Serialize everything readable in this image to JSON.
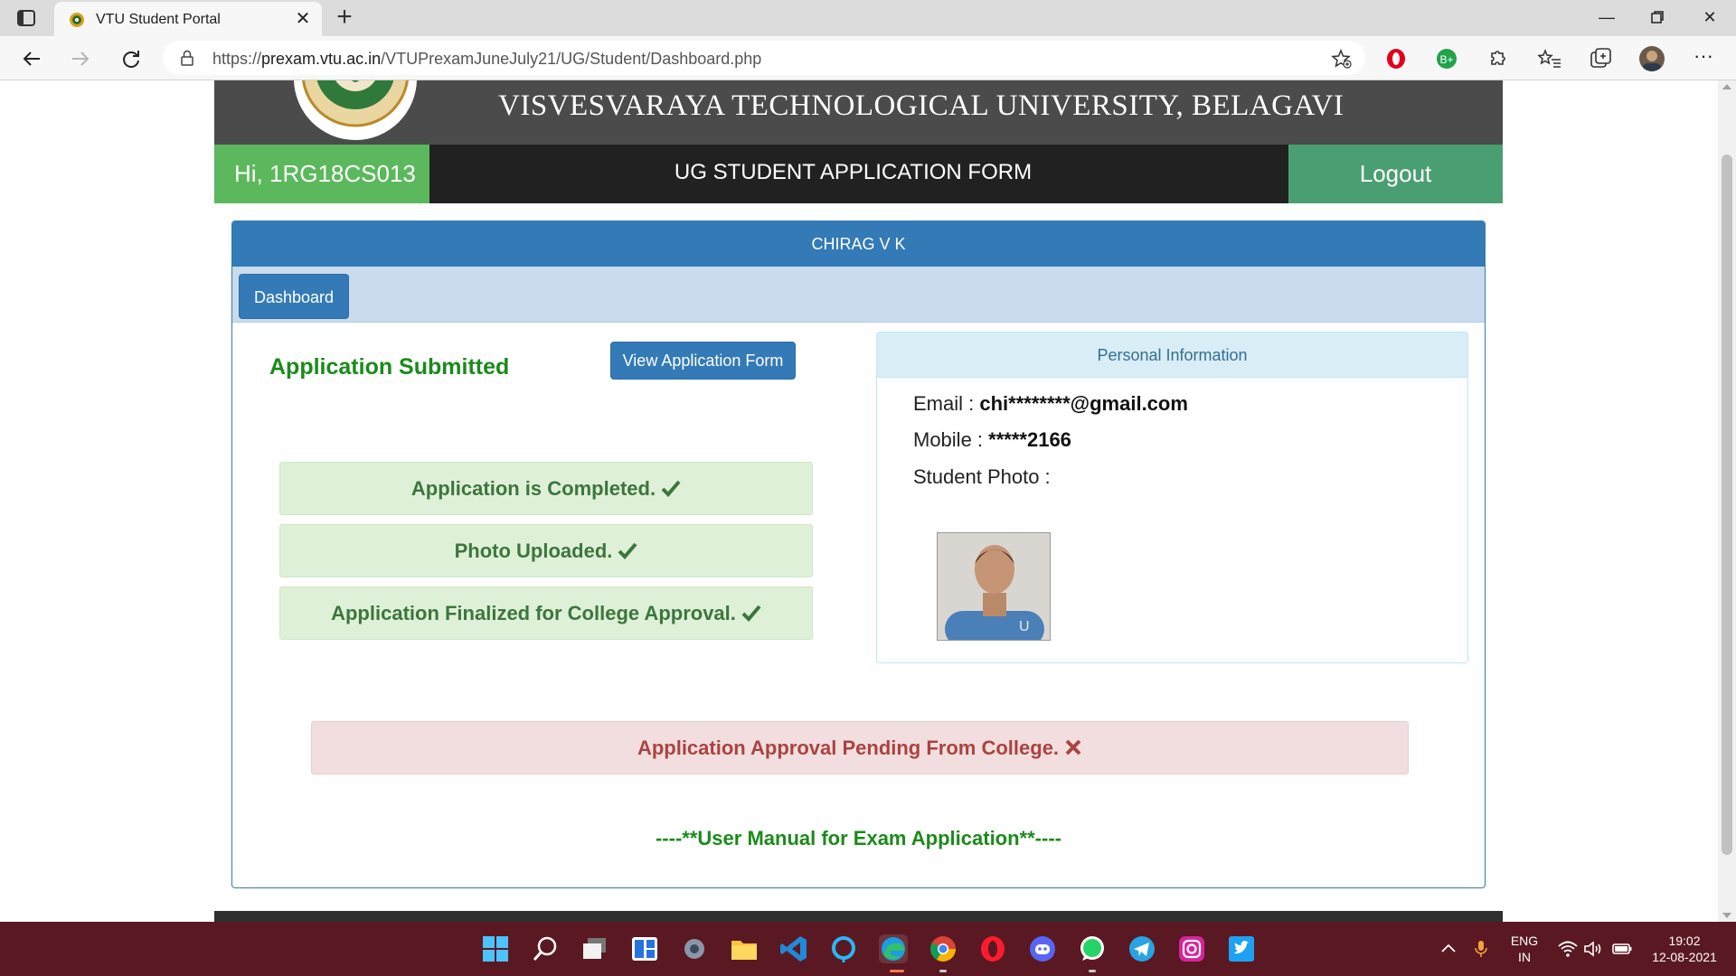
{
  "browser": {
    "tab_title": "VTU Student Portal",
    "url_prefix": "https://",
    "url_host": "prexam.vtu.ac.in",
    "url_path": "/VTUPrexamJuneJuly21/UG/Student/Dashboard.php"
  },
  "header": {
    "university_name": "VISVESVARAYA TECHNOLOGICAL UNIVERSITY, BELAGAVI",
    "greeting": "Hi, 1RG18CS013",
    "form_title": "UG STUDENT APPLICATION FORM",
    "logout_label": "Logout"
  },
  "panel": {
    "student_name": "CHIRAG V K",
    "dashboard_label": "Dashboard",
    "status_heading": "Application Submitted",
    "view_form_label": "View Application Form",
    "status_items": [
      {
        "text": "Application is Completed.",
        "icon": "check-icon",
        "color": "#3c763d"
      },
      {
        "text": "Photo Uploaded.",
        "icon": "check-icon",
        "color": "#3c763d"
      },
      {
        "text": "Application Finalized for College Approval.",
        "icon": "check-icon",
        "color": "#3c763d"
      }
    ],
    "pending_text": "Application Approval Pending From College.",
    "pending_icon": "cross-icon",
    "manual_link": "----**User Manual for Exam Application**----"
  },
  "personal_info": {
    "title": "Personal Information",
    "email_label": "Email :",
    "email_value": "chi********@gmail.com",
    "mobile_label": "Mobile :",
    "mobile_value": "*****2166",
    "photo_label": "Student Photo :"
  },
  "taskbar": {
    "icons": [
      "windows-start-icon",
      "search-icon",
      "task-view-icon",
      "widgets-icon",
      "settings-icon",
      "file-explorer-icon",
      "vscode-icon",
      "cortana-icon",
      "edge-icon",
      "chrome-icon",
      "opera-icon",
      "discord-icon",
      "whatsapp-icon",
      "telegram-icon",
      "instagram-icon",
      "twitter-icon"
    ],
    "lang_top": "ENG",
    "lang_bottom": "IN",
    "time": "19:02",
    "date": "12-08-2021"
  },
  "colors": {
    "success_green": "#5cb85c",
    "primary_blue": "#337ab7",
    "taskbar": "#5a1922",
    "danger_text": "#a94442"
  }
}
